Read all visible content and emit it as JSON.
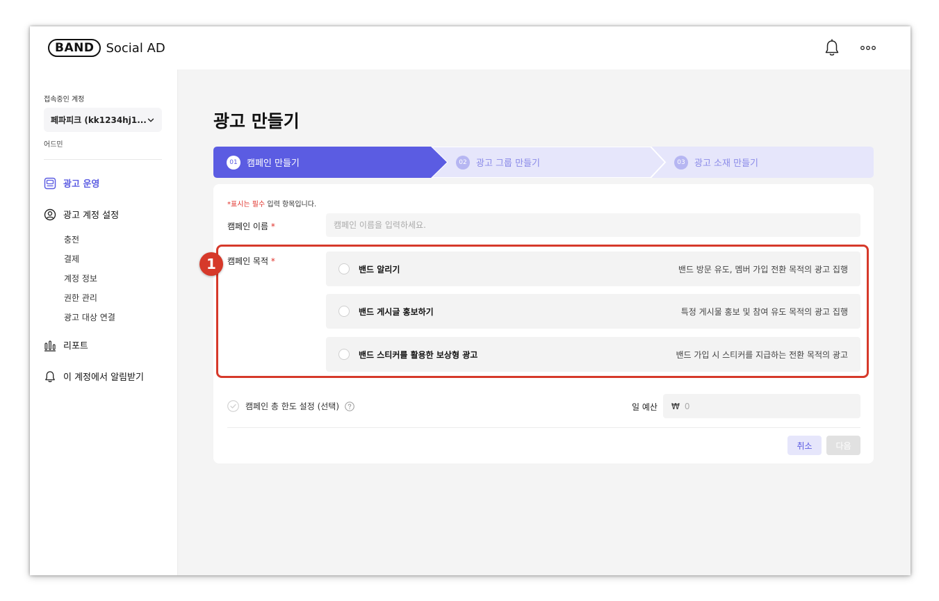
{
  "app": {
    "logo_band": "BAND",
    "logo_text": "Social AD"
  },
  "sidebar": {
    "account_label": "접속중인 계정",
    "account_name": "페파피크 (kk1234hj1...",
    "role": "어드민",
    "nav": {
      "ad_operation": "광고 운영",
      "account_settings": "광고 계정 설정",
      "sub_items": [
        "충전",
        "결제",
        "계정 정보",
        "권한 관리",
        "광고 대상 연결"
      ],
      "report": "리포트",
      "notifications": "이 계정에서 알림받기"
    }
  },
  "page": {
    "title": "광고 만들기",
    "steps": [
      {
        "num": "01",
        "label": "캠페인 만들기"
      },
      {
        "num": "02",
        "label": "광고 그룹 만들기"
      },
      {
        "num": "03",
        "label": "광고 소재 만들기"
      }
    ]
  },
  "form": {
    "required_note_red": "*표시는 필수",
    "required_note_rest": " 입력 항목입니다.",
    "name_label": "캠페인 이름",
    "name_placeholder": "캠페인 이름을 입력하세요.",
    "objective_label": "캠페인 목적",
    "required_star": "*",
    "objectives": [
      {
        "title": "밴드 알리기",
        "desc": "밴드 방문 유도, 멤버 가입 전환 목적의 광고 집행"
      },
      {
        "title": "밴드 게시글 홍보하기",
        "desc": "특정 게시물 홍보 및 참여 유도 목적의 광고 집행"
      },
      {
        "title": "밴드 스티커를 활용한 보상형 광고",
        "desc": "밴드 가입 시 스티커를 지급하는 전환 목적의 광고"
      }
    ],
    "annotation_number": "1",
    "limit_label": "캠페인 총 한도 설정 (선택)",
    "daily_budget_label": "일 예산",
    "currency": "₩",
    "daily_budget_value": "0",
    "cancel_label": "취소",
    "next_label": "다음"
  },
  "colors": {
    "accent": "#5b5ce2",
    "step_inactive_bg": "#e6e6fb",
    "highlight": "#d6392a",
    "required": "#e0322b"
  }
}
